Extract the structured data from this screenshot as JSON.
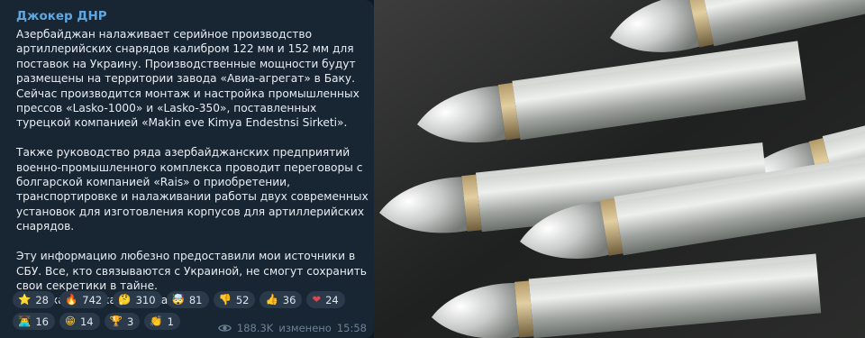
{
  "post": {
    "author": "Джокер ДНР",
    "text": "Азербайджан налаживает серийное производство артиллерийских снарядов калибром 122 мм и 152 мм для поставок на Украину. Производственные мощности будут размещены на территории завода «Авиа-агрегат» в Баку. Сейчас производится монтаж и настройка промышленных прессов «Lasko-1000» и «Lasko-350», поставленных турецкой компанией «Makin eve Kimya Endestnsi Sirketi».\n\nТакже руководство ряда азербайджанских предприятий военно-промышленного комплекса проводит переговоры с болгарской компанией «Rais» о приобретении, транспортировке и налаживании работы двух современных установок для изготовления корпусов для артиллерийских снарядов.\n\nЭту информацию любезно предоставили мои источники в СБУ. Все, кто связываются с Украиной, не смогут сохранить свои секретики в тайне.\nАх-ха-ха-ха-ха-ха-ха-ха-ха-ха...",
    "reactions": [
      {
        "emoji": "⭐",
        "icon": "star-icon",
        "count": "28",
        "color": "#f5b83d"
      },
      {
        "emoji": "🔥",
        "icon": "fire-icon",
        "count": "742",
        "color": "#ff7a2f"
      },
      {
        "emoji": "🤔",
        "icon": "thinking-face-icon",
        "count": "310",
        "color": "#f7c945"
      },
      {
        "emoji": "🤯",
        "icon": "exploding-head-icon",
        "count": "81",
        "color": "#f08a5d"
      },
      {
        "emoji": "👎",
        "icon": "thumbs-down-icon",
        "count": "52",
        "color": "#f7c945"
      },
      {
        "emoji": "👍",
        "icon": "thumbs-up-icon",
        "count": "36",
        "color": "#f7c945"
      },
      {
        "emoji": "❤",
        "icon": "heart-icon",
        "count": "24",
        "color": "#e8424a"
      },
      {
        "emoji": "👨‍💻",
        "icon": "technologist-icon",
        "count": "16",
        "color": "#f7c945"
      },
      {
        "emoji": "😁",
        "icon": "grinning-face-icon",
        "count": "14",
        "color": "#f7c945"
      },
      {
        "emoji": "🏆",
        "icon": "trophy-icon",
        "count": "3",
        "color": "#f5b83d"
      },
      {
        "emoji": "👏",
        "icon": "clapping-hands-icon",
        "count": "1",
        "color": "#f7c945"
      }
    ],
    "views": "188.3K",
    "edited_label": "изменено",
    "time": "15:58"
  },
  "photo": {
    "icon": "artillery-shells-image"
  },
  "colors": {
    "bubble": "#182533",
    "author": "#5fa7e0",
    "text": "#e8edf2",
    "reaction_bg": "#2b3a4a",
    "meta": "#6d8196"
  }
}
